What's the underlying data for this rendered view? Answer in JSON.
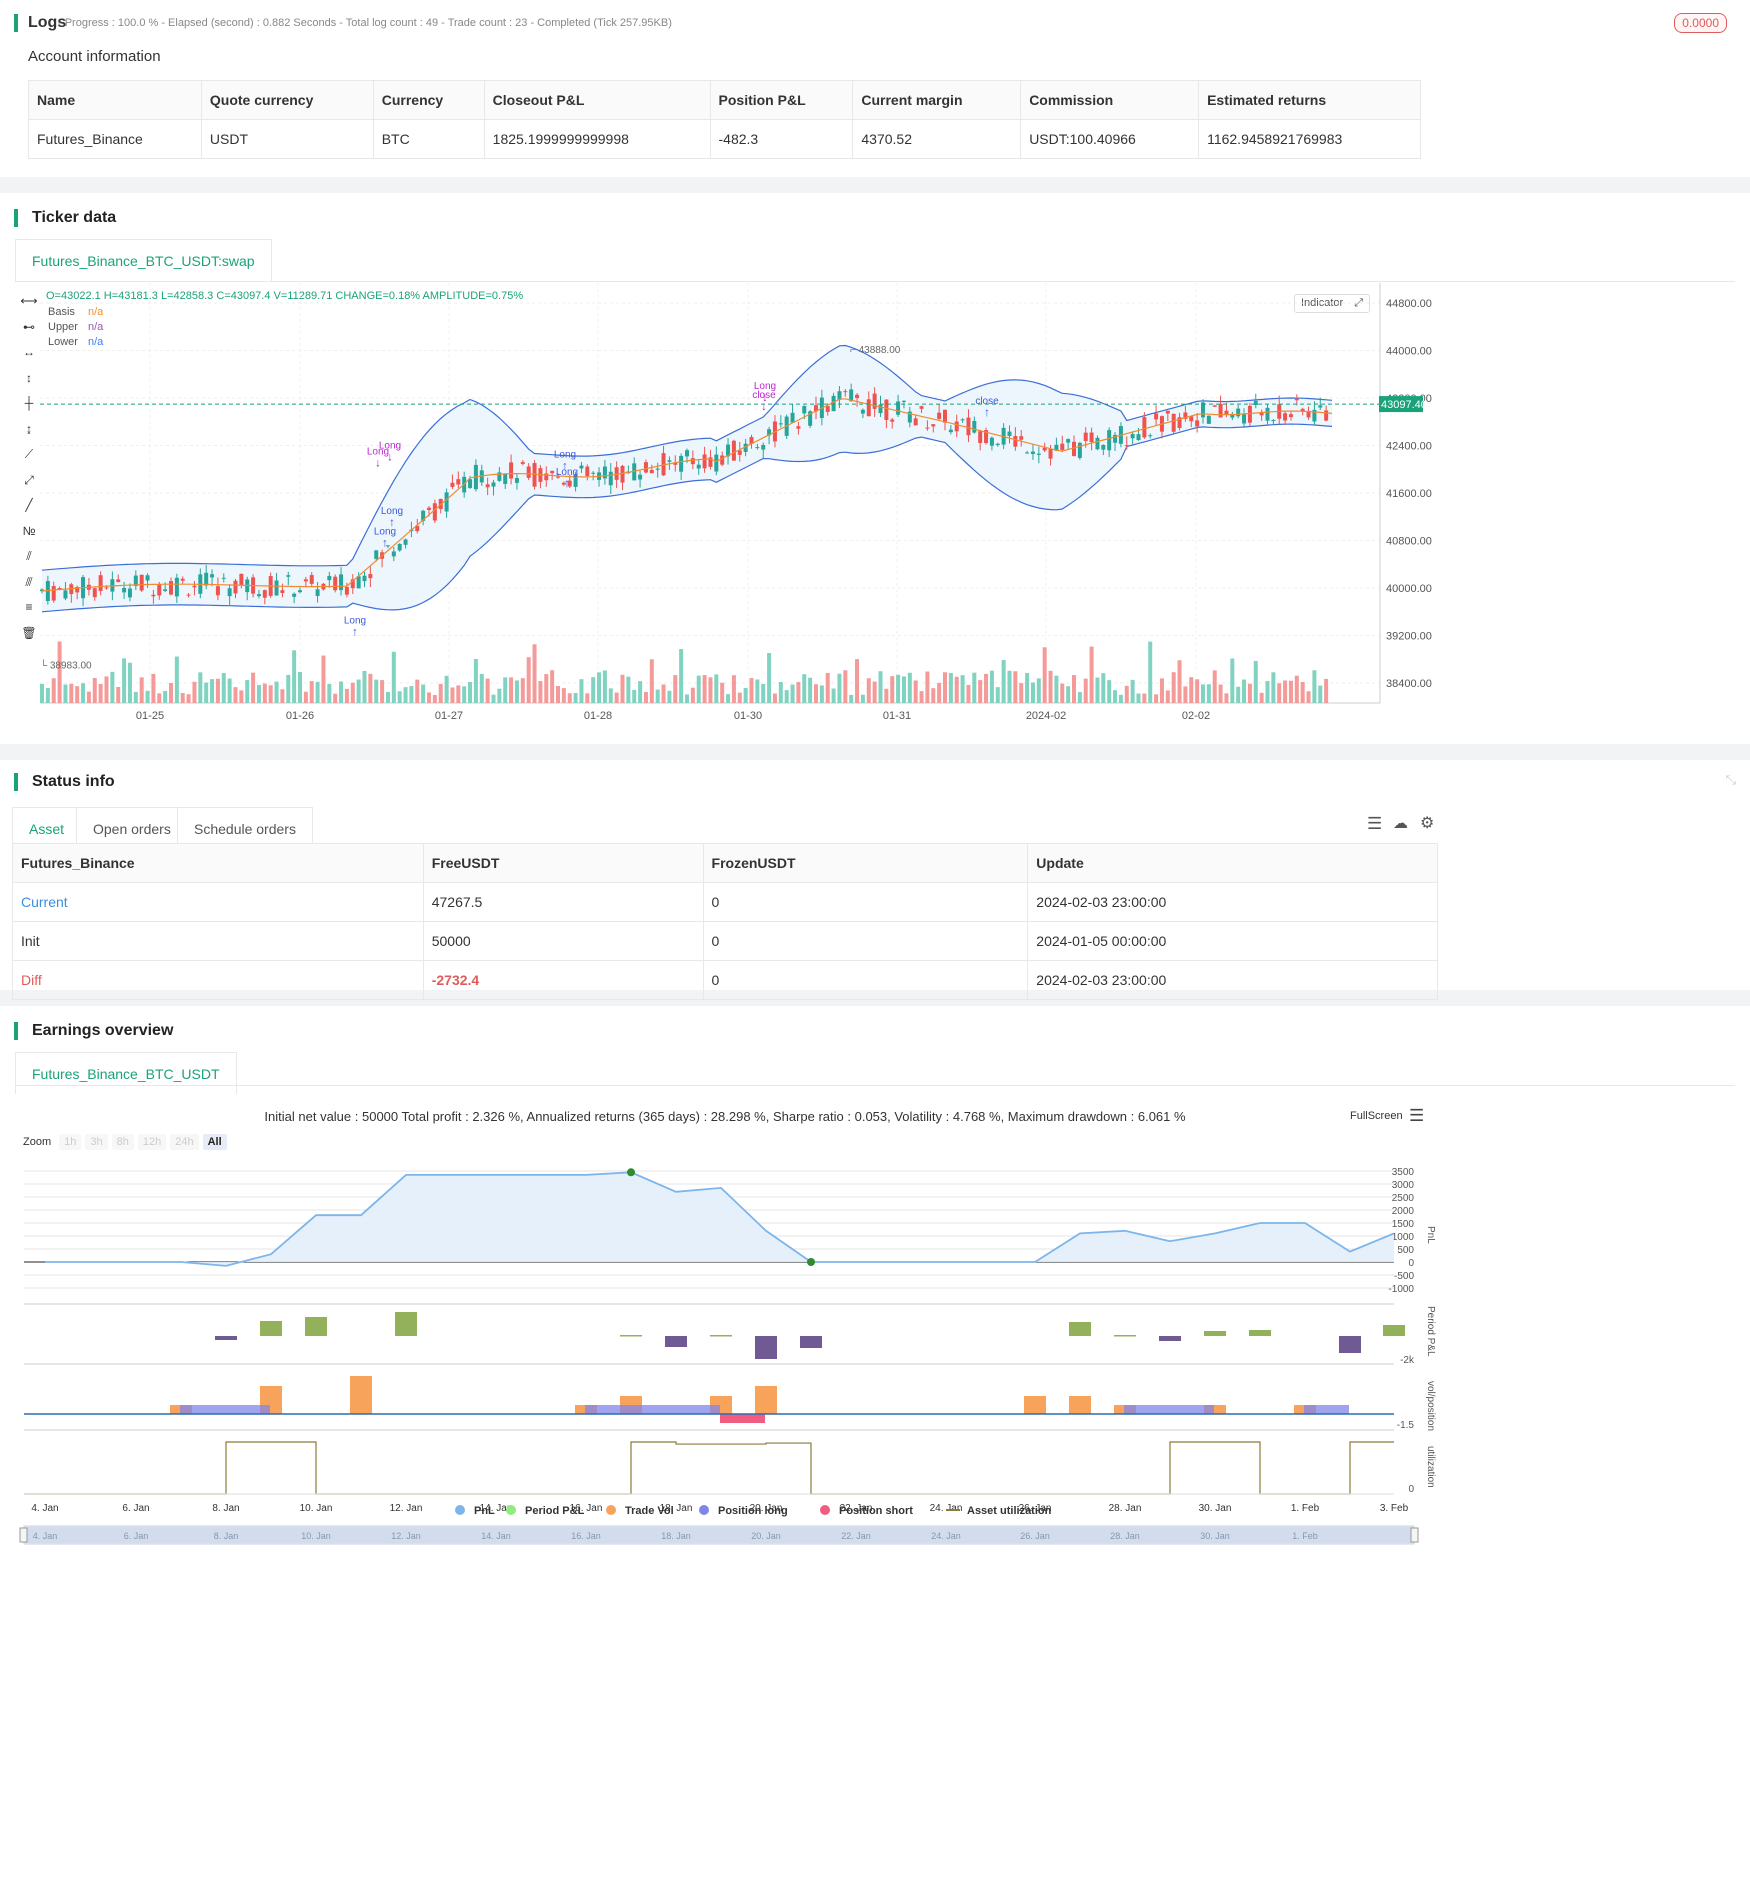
{
  "logs": {
    "title": "Logs",
    "summary": "- Progress : 100.0 % - Elapsed (second) : 0.882  Seconds - Total log count : 49 - Trade count : 23 - Completed (Tick 257.95KB)",
    "badge": "0.0000"
  },
  "account": {
    "title": "Account information",
    "headers": [
      "Name",
      "Quote currency",
      "Currency",
      "Closeout P&L",
      "Position P&L",
      "Current margin",
      "Commission",
      "Estimated returns"
    ],
    "row": [
      "Futures_Binance",
      "USDT",
      "BTC",
      "1825.1999999999998",
      "-482.3",
      "4370.52",
      "USDT:100.40966",
      "1162.9458921769983"
    ]
  },
  "ticker": {
    "title": "Ticker data",
    "tab": "Futures_Binance_BTC_USDT:swap",
    "ohlc": "O=43022.1 H=43181.3 L=42858.3 C=43097.4 V=11289.71 CHANGE=0.18% AMPLITUDE=0.75%",
    "legend": [
      {
        "name": "Basis",
        "value": "n/a",
        "color": "#f0932b"
      },
      {
        "name": "Upper",
        "value": "n/a",
        "color": "#9b59b6"
      },
      {
        "name": "Lower",
        "value": "n/a",
        "color": "#3b82f6"
      }
    ],
    "indicator_button": "Indicator",
    "price_labels": [
      "44800.00",
      "44000.00",
      "43200.00",
      "42400.00",
      "41600.00",
      "40800.00",
      "40000.00",
      "39200.00",
      "38400.00"
    ],
    "current_price": "43097.40",
    "high_label": "43888.00",
    "low_label": "38983.00",
    "x_labels": [
      "01-25",
      "01-26",
      "01-27",
      "01-28",
      "01-30",
      "01-31",
      "2024-02",
      "02-02"
    ],
    "signals": [
      "Long",
      "Long",
      "Long",
      "Long",
      "Long",
      "Long",
      "Long",
      "close",
      "Long",
      "close"
    ]
  },
  "status": {
    "title": "Status info",
    "tabs": [
      "Asset",
      "Open orders",
      "Schedule orders"
    ],
    "headers": [
      "Futures_Binance",
      "FreeUSDT",
      "FrozenUSDT",
      "Update"
    ],
    "rows": [
      [
        "Current",
        "47267.5",
        "0",
        "2024-02-03 23:00:00"
      ],
      [
        "Init",
        "50000",
        "0",
        "2024-01-05 00:00:00"
      ],
      [
        "Diff",
        "-2732.4",
        "0",
        "2024-02-03 23:00:00"
      ]
    ]
  },
  "earnings": {
    "title": "Earnings overview",
    "tab": "Futures_Binance_BTC_USDT",
    "summary": "Initial net value : 50000 Total profit : 2.326 %, Annualized returns (365 days) : 28.298 %, Sharpe ratio : 0.053, Volatility : 4.768 %, Maximum drawdown : 6.061 %",
    "fullscreen": "FullScreen",
    "zoom_label": "Zoom",
    "zoom_options": [
      "1h",
      "3h",
      "8h",
      "12h",
      "24h",
      "All"
    ],
    "pnl_axis": [
      "3500",
      "3000",
      "2500",
      "2000",
      "1500",
      "1000",
      "500",
      "0",
      "-500",
      "-1000"
    ],
    "pnl_title": "PnL",
    "period_title": "Period P&L",
    "period_axis": [
      "-2k"
    ],
    "vol_title": "vol/position",
    "vol_axis": [
      "-1.5"
    ],
    "util_title": "utilization",
    "util_axis": [
      "0"
    ],
    "x_labels": [
      "4. Jan",
      "6. Jan",
      "8. Jan",
      "10. Jan",
      "12. Jan",
      "14. Jan",
      "16. Jan",
      "18. Jan",
      "20. Jan",
      "22. Jan",
      "24. Jan",
      "26. Jan",
      "28. Jan",
      "30. Jan",
      "1. Feb",
      "3. Feb"
    ],
    "legend": [
      {
        "name": "PnL",
        "color": "#7cb5ec"
      },
      {
        "name": "Period P&L",
        "color": "#90ed7d"
      },
      {
        "name": "Trade Vol",
        "color": "#f7a35c"
      },
      {
        "name": "Position long",
        "color": "#8085e9"
      },
      {
        "name": "Position short",
        "color": "#f15c80"
      },
      {
        "name": "Asset utilization",
        "color": "#8d7b3a"
      }
    ],
    "navigator_labels": [
      "4. Jan",
      "6. Jan",
      "8. Jan",
      "10. Jan",
      "12. Jan",
      "14. Jan",
      "16. Jan",
      "18. Jan",
      "20. Jan",
      "22. Jan",
      "24. Jan",
      "26. Jan",
      "28. Jan",
      "30. Jan",
      "1. Feb"
    ]
  }
}
